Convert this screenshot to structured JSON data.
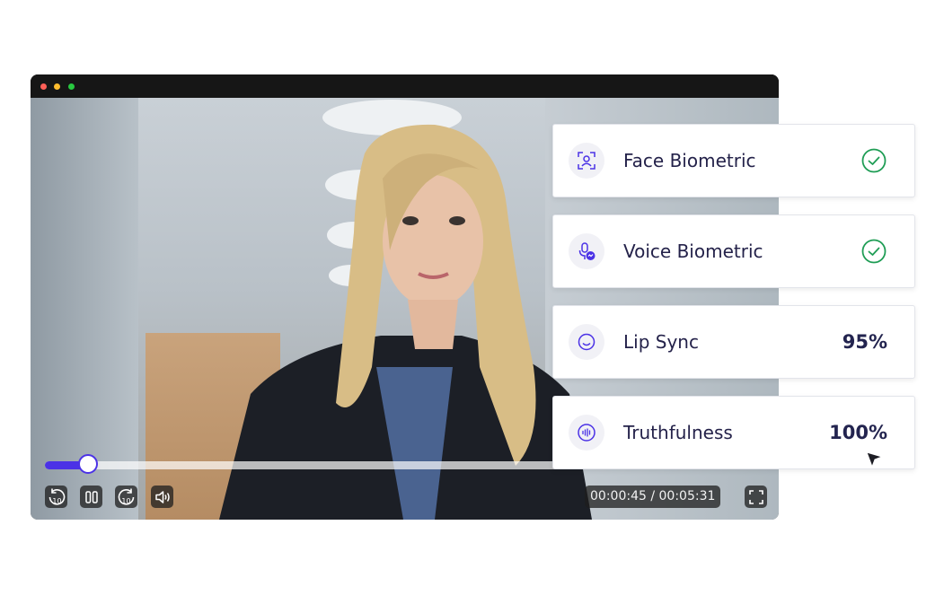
{
  "window": {
    "traffic_lights": [
      "#ff5f57",
      "#febc2e",
      "#28c840"
    ]
  },
  "player": {
    "progress_percent": 6,
    "accent_color": "#4b32e6",
    "rewind_label": "10",
    "forward_label": "10",
    "current_time": "00:00:45",
    "time_separator": "/",
    "total_time": "00:05:31",
    "controls": [
      "rewind-10-icon",
      "pause-icon",
      "forward-10-icon",
      "volume-icon",
      "fullscreen-icon"
    ]
  },
  "checks": [
    {
      "label": "Face Biometric",
      "icon": "face-scan-icon",
      "status": "verified",
      "status_color": "#1f9d55"
    },
    {
      "label": "Voice Biometric",
      "icon": "microphone-icon",
      "status": "verified",
      "status_color": "#1f9d55"
    },
    {
      "label": "Lip Sync",
      "icon": "smile-icon",
      "value": "95%"
    },
    {
      "label": "Truthfulness",
      "icon": "waveform-icon",
      "value": "100%"
    }
  ],
  "icon_color": "#4b32e6"
}
